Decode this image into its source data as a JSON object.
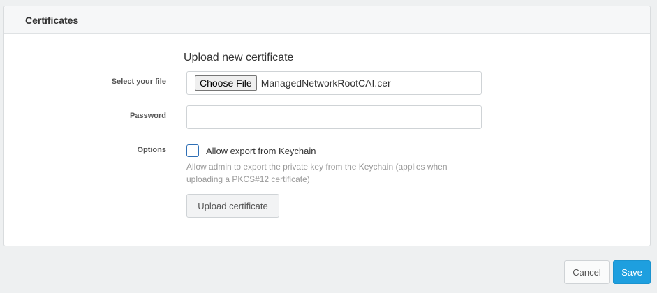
{
  "panel": {
    "title": "Certificates"
  },
  "upload": {
    "section_title": "Upload new certificate",
    "file_label": "Select your file",
    "choose_file_label": "Choose File",
    "file_name": "ManagedNetworkRootCAI.cer",
    "password_label": "Password",
    "password_value": "",
    "options_label": "Options",
    "allow_export_label": "Allow export from Keychain",
    "allow_export_checked": false,
    "allow_export_help": "Allow admin to export the private key from the Keychain (applies when uploading a PKCS#12 certificate)",
    "upload_button_label": "Upload certificate"
  },
  "footer": {
    "cancel_label": "Cancel",
    "save_label": "Save"
  },
  "colors": {
    "primary": "#1e9fdf",
    "checkbox_border": "#2f6fb5",
    "background": "#eef0f1"
  }
}
